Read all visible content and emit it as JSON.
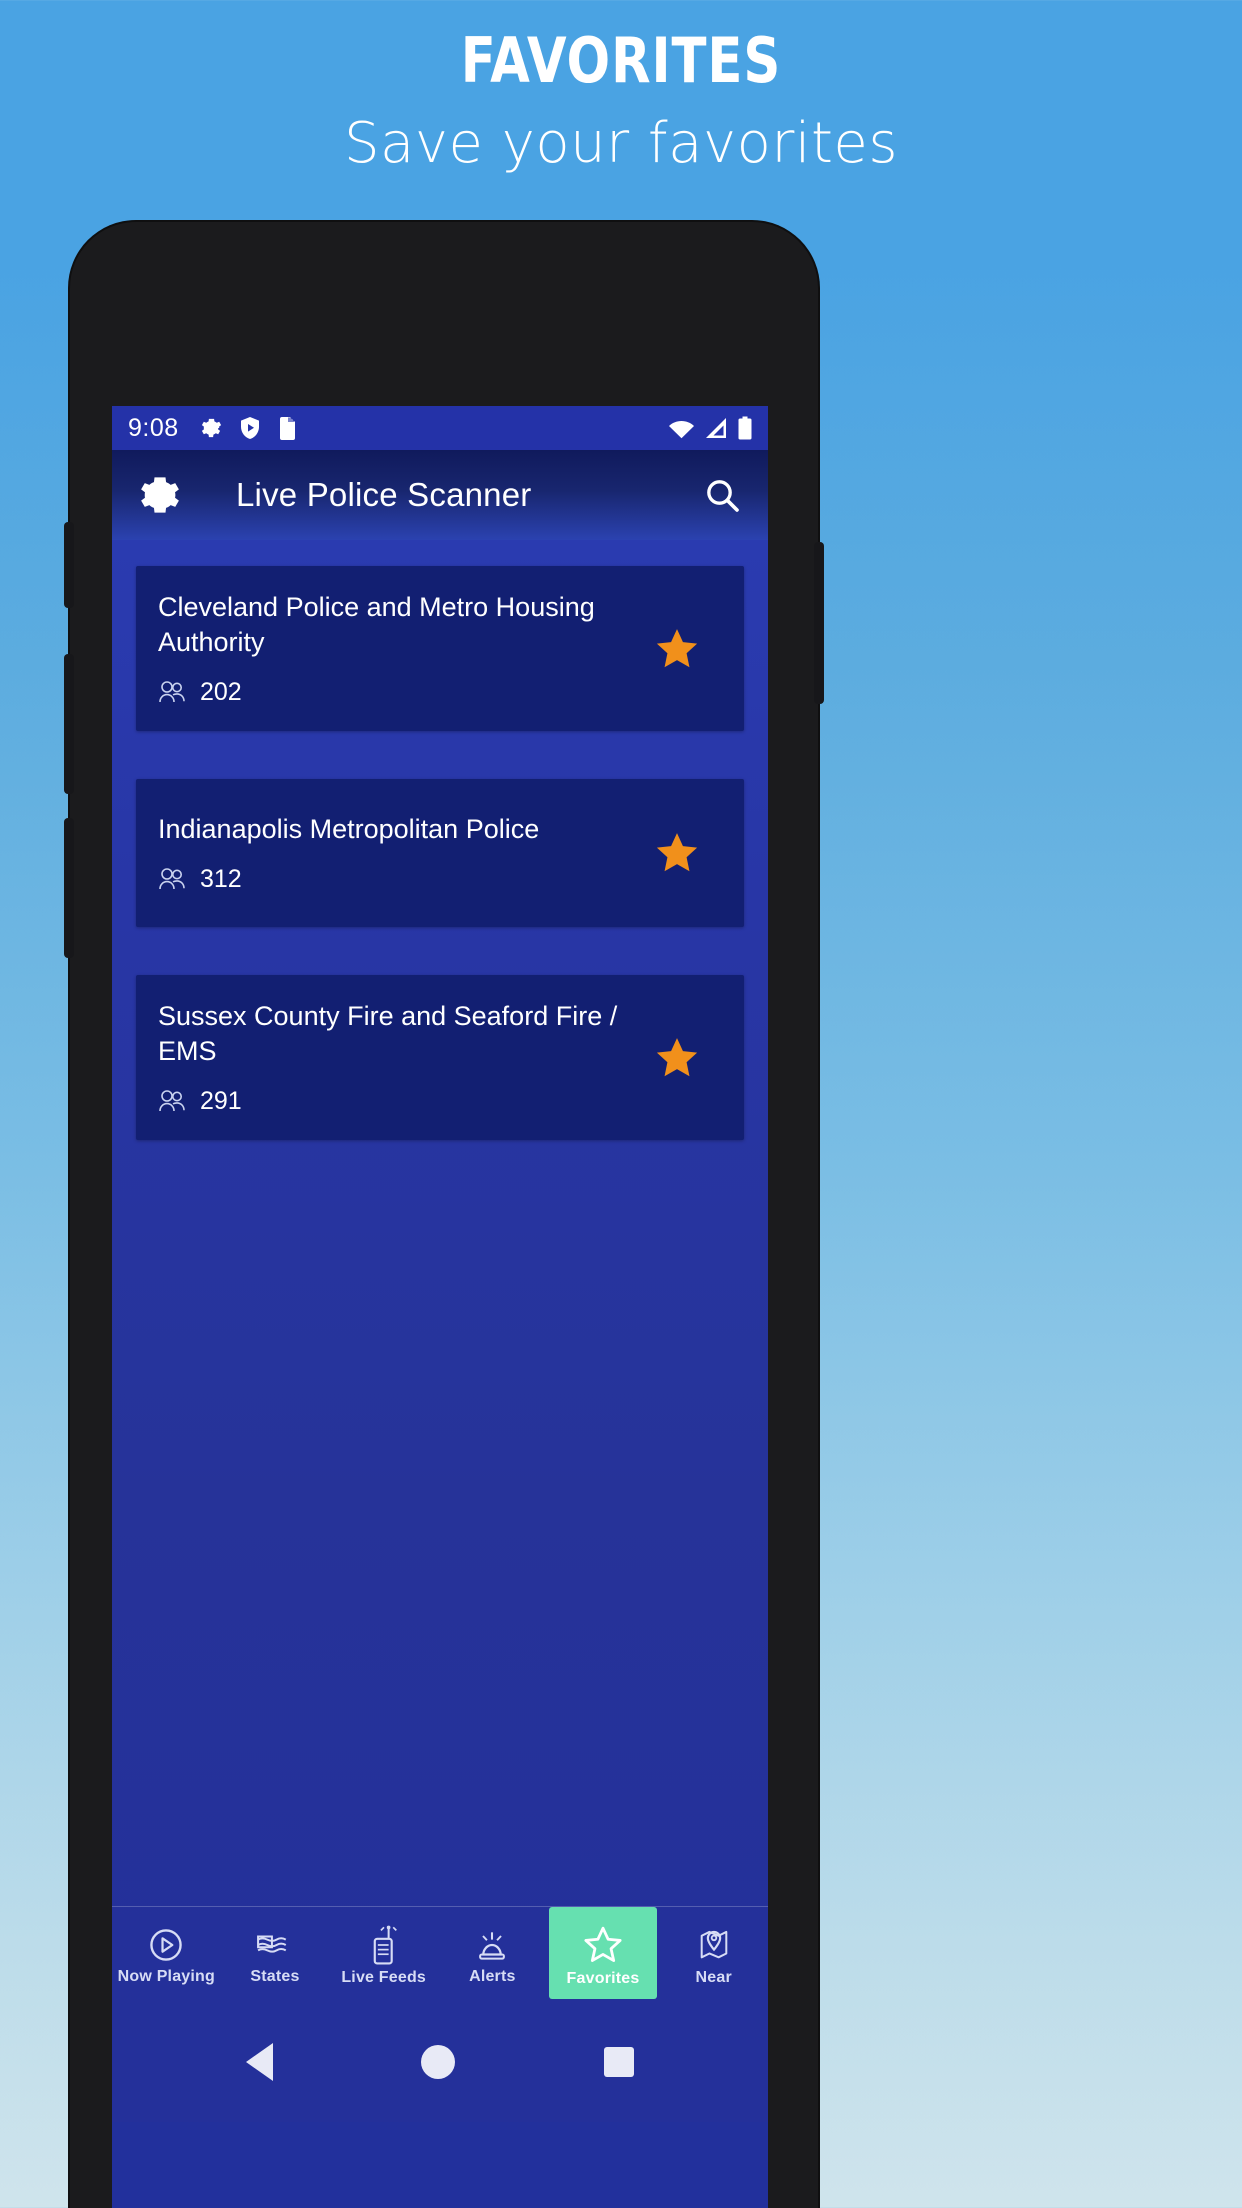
{
  "promo": {
    "title": "FAVORITES",
    "subtitle": "Save your favorites"
  },
  "colors": {
    "background_top": "#4aa3e3",
    "background_bottom": "#cfe4ec",
    "app_primary": "#2432a8",
    "card": "#121f72",
    "star": "#f1901b",
    "active_tab": "#66e0b0"
  },
  "statusbar": {
    "clock": "9:08",
    "left_icons": [
      "gear-icon",
      "shield-play-icon",
      "sd-card-icon"
    ],
    "right_icons": [
      "wifi-icon",
      "cellular-signal-icon",
      "battery-icon"
    ]
  },
  "appbar": {
    "menu_icon": "gear-icon",
    "title": "Live Police Scanner",
    "search_icon": "search-icon"
  },
  "feeds": [
    {
      "name": "Cleveland Police and Metro Housing Authority",
      "listeners": "202",
      "favorited": true
    },
    {
      "name": "Indianapolis Metropolitan Police",
      "listeners": "312",
      "favorited": true
    },
    {
      "name": "Sussex County Fire and Seaford Fire / EMS",
      "listeners": "291",
      "favorited": true
    }
  ],
  "bottom_nav": {
    "items": [
      {
        "label": "Now Playing",
        "icon": "play-circle-icon",
        "active": false
      },
      {
        "label": "States",
        "icon": "usa-map-icon",
        "active": false
      },
      {
        "label": "Live Feeds",
        "icon": "radio-scanner-icon",
        "active": false
      },
      {
        "label": "Alerts",
        "icon": "siren-icon",
        "active": false
      },
      {
        "label": "Favorites",
        "icon": "star-outline-icon",
        "active": true
      },
      {
        "label": "Near",
        "icon": "map-pin-icon",
        "active": false
      }
    ]
  },
  "android_nav": {
    "back": "back-triangle-icon",
    "home": "home-circle-icon",
    "recents": "recents-square-icon"
  }
}
